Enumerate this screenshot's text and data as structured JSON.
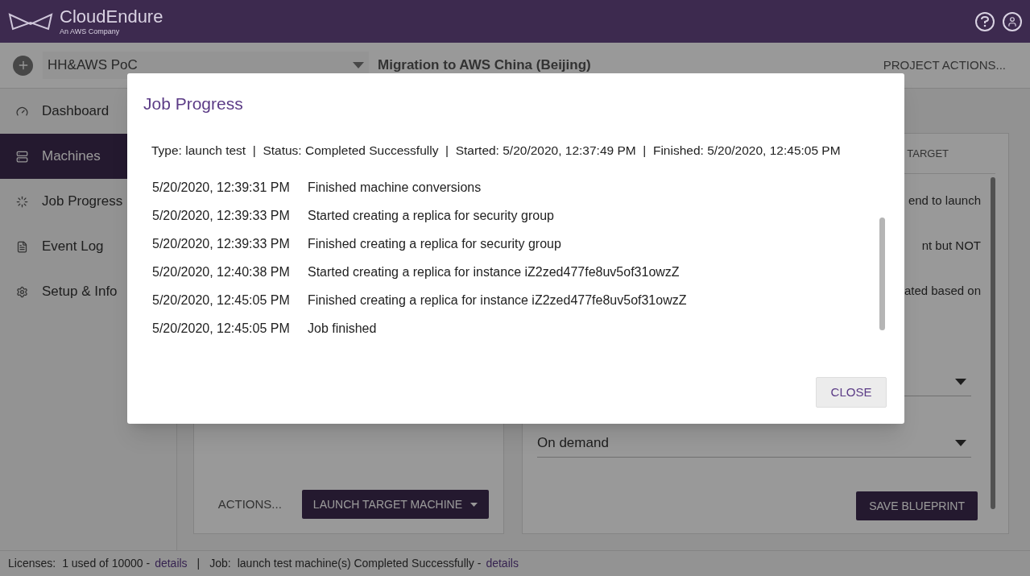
{
  "header": {
    "logo": "CloudEndure",
    "tagline": "An AWS Company"
  },
  "project_bar": {
    "project": "HH&AWS PoC",
    "title": "Migration to AWS China (Beijing)",
    "actions": "PROJECT ACTIONS..."
  },
  "sidebar": {
    "items": [
      {
        "label": "Dashboard",
        "selected": false
      },
      {
        "label": "Machines",
        "selected": true
      },
      {
        "label": "Job Progress",
        "selected": false
      },
      {
        "label": "Event Log",
        "selected": false
      },
      {
        "label": "Setup & Info",
        "selected": false
      }
    ]
  },
  "left_card": {
    "actions": "ACTIONS...",
    "launch_button": "LAUNCH TARGET MACHINE"
  },
  "right_card": {
    "tab": "TARGET",
    "texts": [
      "end to launch",
      "nt but NOT",
      "ated based on"
    ],
    "dropdown_value": "On demand",
    "save_button": "SAVE BLUEPRINT"
  },
  "status_bar": {
    "licenses_label": "Licenses:",
    "licenses_value": "1 used of 10000 -",
    "licenses_link": "details",
    "separator": "|",
    "job_label": "Job:",
    "job_value": "launch test machine(s) Completed Successfully -",
    "job_link": "details"
  },
  "dialog": {
    "title": "Job Progress",
    "summary": "Type: launch test  |  Status: Completed Successfully  |  Started: 5/20/2020, 12:37:49 PM  |  Finished: 5/20/2020, 12:45:05 PM",
    "log": [
      {
        "time": "5/20/2020, 12:39:31 PM",
        "message": "Finished machine conversions"
      },
      {
        "time": "5/20/2020, 12:39:33 PM",
        "message": "Started creating a replica for security group"
      },
      {
        "time": "5/20/2020, 12:39:33 PM",
        "message": "Finished creating a replica for security group"
      },
      {
        "time": "5/20/2020, 12:40:38 PM",
        "message": "Started creating a replica for instance iZ2zed477fe8uv5of31owzZ"
      },
      {
        "time": "5/20/2020, 12:45:05 PM",
        "message": "Finished creating a replica for instance iZ2zed477fe8uv5of31owzZ"
      },
      {
        "time": "5/20/2020, 12:45:05 PM",
        "message": "Job finished"
      }
    ],
    "close": "CLOSE"
  }
}
